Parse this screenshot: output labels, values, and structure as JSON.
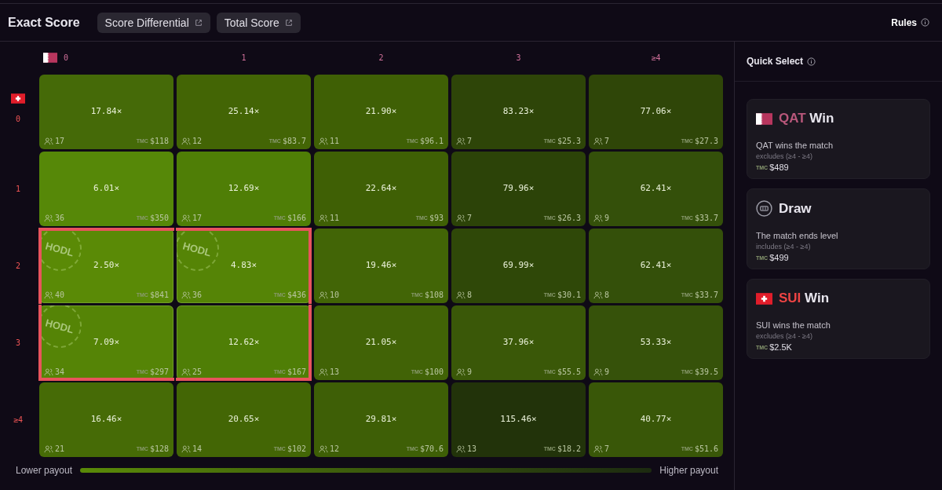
{
  "header": {
    "title": "Exact Score",
    "links": [
      "Score Differential",
      "Total Score"
    ],
    "rules": "Rules"
  },
  "grid": {
    "column_headers": [
      "0",
      "1",
      "2",
      "3",
      "≥4"
    ],
    "row_headers": [
      "0",
      "1",
      "2",
      "3",
      "≥4"
    ],
    "rows": [
      [
        {
          "odds": "17.84×",
          "bettors": "17",
          "token": "TMC",
          "pool": "$118",
          "color": "#456a08",
          "selected": false
        },
        {
          "odds": "25.14×",
          "bettors": "12",
          "token": "TMC",
          "pool": "$83.7",
          "color": "#436505",
          "selected": false
        },
        {
          "odds": "21.90×",
          "bettors": "11",
          "token": "TMC",
          "pool": "$96.1",
          "color": "#3f6005",
          "selected": false
        },
        {
          "odds": "83.23×",
          "bettors": "7",
          "token": "TMC",
          "pool": "$25.3",
          "color": "#2e4508",
          "selected": false
        },
        {
          "odds": "77.06×",
          "bettors": "7",
          "token": "TMC",
          "pool": "$27.3",
          "color": "#2f4608",
          "selected": false
        }
      ],
      [
        {
          "odds": "6.01×",
          "bettors": "36",
          "token": "TMC",
          "pool": "$350",
          "color": "#568808",
          "selected": false
        },
        {
          "odds": "12.69×",
          "bettors": "17",
          "token": "TMC",
          "pool": "$166",
          "color": "#4f7e06",
          "selected": false
        },
        {
          "odds": "22.64×",
          "bettors": "11",
          "token": "TMC",
          "pool": "$93",
          "color": "#3f6005",
          "selected": false
        },
        {
          "odds": "79.96×",
          "bettors": "7",
          "token": "TMC",
          "pool": "$26.3",
          "color": "#2c4308",
          "selected": false
        },
        {
          "odds": "62.41×",
          "bettors": "9",
          "token": "TMC",
          "pool": "$33.7",
          "color": "#34500a",
          "selected": false
        }
      ],
      [
        {
          "odds": "2.50×",
          "bettors": "40",
          "token": "TMC",
          "pool": "$841",
          "color": "#5a8a06",
          "selected": true,
          "stamp": "HODL"
        },
        {
          "odds": "4.83×",
          "bettors": "36",
          "token": "TMC",
          "pool": "$436",
          "color": "#558406",
          "selected": true,
          "stamp": "HODL"
        },
        {
          "odds": "19.46×",
          "bettors": "10",
          "token": "TMC",
          "pool": "$108",
          "color": "#426506",
          "selected": false
        },
        {
          "odds": "69.99×",
          "bettors": "8",
          "token": "TMC",
          "pool": "$30.1",
          "color": "#2f4808",
          "selected": false
        },
        {
          "odds": "62.41×",
          "bettors": "8",
          "token": "TMC",
          "pool": "$33.7",
          "color": "#34500a",
          "selected": false
        }
      ],
      [
        {
          "odds": "7.09×",
          "bettors": "34",
          "token": "TMC",
          "pool": "$297",
          "color": "#558406",
          "selected": true,
          "stamp": "HODL"
        },
        {
          "odds": "12.62×",
          "bettors": "25",
          "token": "TMC",
          "pool": "$167",
          "color": "#4f7e06",
          "selected": true
        },
        {
          "odds": "21.05×",
          "bettors": "13",
          "token": "TMC",
          "pool": "$100",
          "color": "#416306",
          "selected": false
        },
        {
          "odds": "37.96×",
          "bettors": "9",
          "token": "TMC",
          "pool": "$55.5",
          "color": "#3a5808",
          "selected": false
        },
        {
          "odds": "53.33×",
          "bettors": "9",
          "token": "TMC",
          "pool": "$39.5",
          "color": "#36520a",
          "selected": false
        }
      ],
      [
        {
          "odds": "16.46×",
          "bettors": "21",
          "token": "TMC",
          "pool": "$128",
          "color": "#466b06",
          "selected": false
        },
        {
          "odds": "20.65×",
          "bettors": "14",
          "token": "TMC",
          "pool": "$102",
          "color": "#436605",
          "selected": false
        },
        {
          "odds": "29.81×",
          "bettors": "12",
          "token": "TMC",
          "pool": "$70.6",
          "color": "#3e5f06",
          "selected": false
        },
        {
          "odds": "115.46×",
          "bettors": "13",
          "token": "TMC",
          "pool": "$18.2",
          "color": "#22330a",
          "selected": false
        },
        {
          "odds": "40.77×",
          "bettors": "7",
          "token": "TMC",
          "pool": "$51.6",
          "color": "#395708",
          "selected": false
        }
      ]
    ]
  },
  "legend": {
    "low": "Lower payout",
    "high": "Higher payout"
  },
  "quick_select": {
    "title": "Quick Select",
    "options": [
      {
        "kind": "qatar",
        "team": "QAT",
        "label": "Win",
        "description": "QAT wins the match",
        "note": "excludes (≥4 - ≥4)",
        "token": "TMC",
        "pool": "$489"
      },
      {
        "kind": "draw",
        "label": "Draw",
        "description": "The match ends level",
        "note": "includes (≥4 - ≥4)",
        "token": "TMC",
        "pool": "$499"
      },
      {
        "kind": "swiss",
        "team": "SUI",
        "label": "Win",
        "description": "SUI wins the match",
        "note": "excludes (≥4 - ≥4)",
        "token": "TMC",
        "pool": "$2.5K"
      }
    ]
  }
}
